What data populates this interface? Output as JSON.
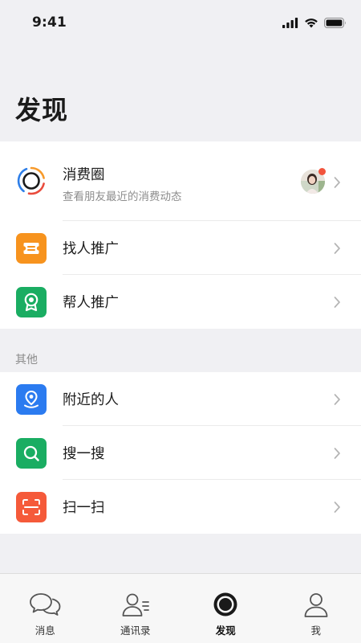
{
  "status_bar": {
    "time": "9:41"
  },
  "page": {
    "title": "发现"
  },
  "moments": {
    "title": "消费圈",
    "subtitle": "查看朋友最近的消费动态"
  },
  "promo_items": [
    {
      "label": "找人推广",
      "icon": "ticket-icon",
      "color": "#F7931E"
    },
    {
      "label": "帮人推广",
      "icon": "award-icon",
      "color": "#1AAD62"
    }
  ],
  "other_section": {
    "label": "其他"
  },
  "other_items": [
    {
      "label": "附近的人",
      "icon": "location-pin-icon",
      "color": "#2B7BF0"
    },
    {
      "label": "搜一搜",
      "icon": "search-icon",
      "color": "#1AAD62"
    },
    {
      "label": "扫一扫",
      "icon": "scan-icon",
      "color": "#F55A3A"
    }
  ],
  "tabbar": {
    "tabs": [
      {
        "label": "消息",
        "icon": "chat-bubbles-icon"
      },
      {
        "label": "通讯录",
        "icon": "contacts-icon"
      },
      {
        "label": "发现",
        "icon": "discover-icon",
        "active": true
      },
      {
        "label": "我",
        "icon": "person-icon"
      }
    ]
  }
}
